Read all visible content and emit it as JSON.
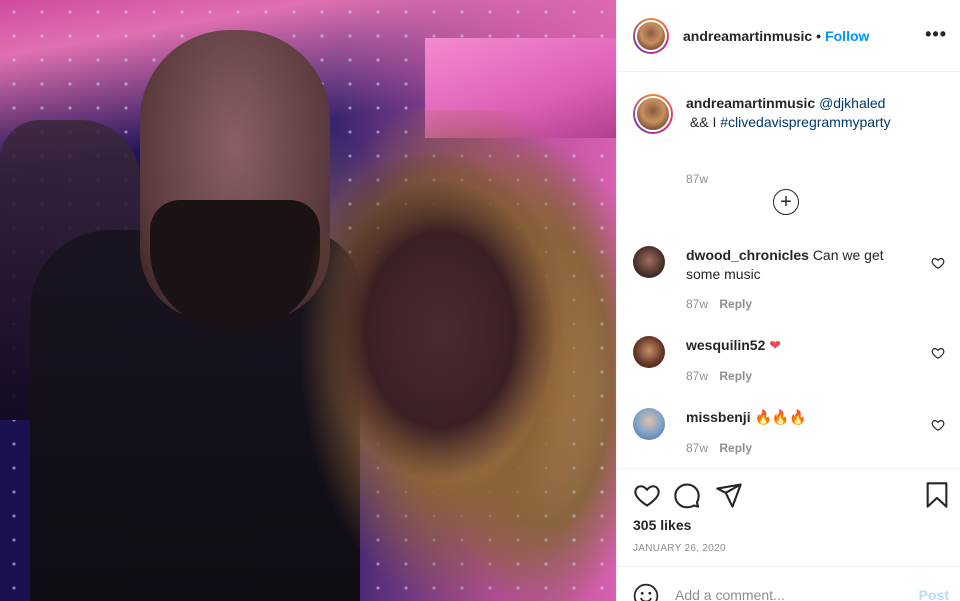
{
  "post": {
    "image_alt": "",
    "author": "andreamartinmusic",
    "follow_label": "Follow",
    "more_label": "•••",
    "caption": {
      "username": "andreamartinmusic",
      "mention": "@djkhaled",
      "text_between": " && I ",
      "hashtag": "#clivedavispregrammyparty",
      "time": "87w"
    },
    "load_more_label": "+",
    "comments": [
      {
        "username": "dwood_chronicles",
        "text": "Can we get some music",
        "time": "87w",
        "reply_label": "Reply"
      },
      {
        "username": "wesquilin52",
        "text": "❤",
        "time": "87w",
        "reply_label": "Reply"
      },
      {
        "username": "missbenji",
        "text": "🔥🔥🔥",
        "time": "87w",
        "reply_label": "Reply"
      }
    ],
    "likes": "305 likes",
    "date": "JANUARY 26, 2020",
    "add_comment_placeholder": "Add a comment...",
    "post_label": "Post"
  },
  "colors": {
    "link": "#00376b",
    "follow": "#0095f6",
    "post_disabled": "#b2dffc",
    "muted": "#8e8e8e",
    "heart_red": "#ed4956"
  },
  "icons": [
    "ellipsis-icon",
    "add-circle-icon",
    "heart-icon",
    "comment-icon",
    "share-icon",
    "bookmark-icon",
    "emoji-icon"
  ]
}
